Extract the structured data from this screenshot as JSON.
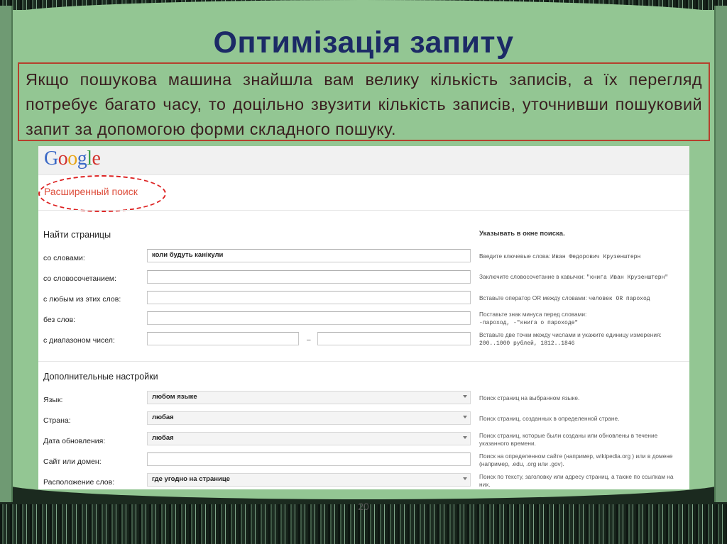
{
  "slide": {
    "title": "Оптимізація запиту",
    "text": "Якщо пошукова машина знайшла вам велику кількість записів, а їх перегляд  потребує багато часу, то доцільно звузити кількість записів, уточнивши пошуковий запит за допомогою форми складного пошуку.",
    "page_number": "20"
  },
  "google": {
    "logo": [
      "G",
      "o",
      "o",
      "g",
      "l",
      "e"
    ],
    "page_title": "Расширенный поиск",
    "find_pages": {
      "heading": "Найти страницы",
      "hint_heading": "Указывать в окне поиска.",
      "rows": [
        {
          "label": "со словами:",
          "value": "коли будуть канікули",
          "hint": "Введите ключевые слова: ",
          "hint_code": "Иван Федорович Крузенштерн",
          "hint_end": ""
        },
        {
          "label": "со словосочетанием:",
          "value": "",
          "hint": "Заключите словосочетание в кавычки: ",
          "hint_code": "\"книга Иван Крузенштерн\"",
          "hint_end": ""
        },
        {
          "label": "с любым из этих слов:",
          "value": "",
          "hint": "Вставьте оператор OR между словами: ",
          "hint_code": "человек OR пароход",
          "hint_end": ""
        },
        {
          "label": "без слов:",
          "value": "",
          "hint": "Поставьте знак минуса перед словами:",
          "hint_code": "-пароход, -\"книга о пароходе\"",
          "hint_end": ""
        },
        {
          "label": "с диапазоном чисел:",
          "value": "",
          "hint": "Вставьте две точки между числами и укажите единицу измерения:",
          "hint_code": "200..1000 рублей, 1812..1846",
          "hint_end": ""
        }
      ],
      "range_dash": "–"
    },
    "advanced": {
      "heading": "Дополнительные настройки",
      "rows": [
        {
          "label": "Язык:",
          "value": "любом языке",
          "hint": "Поиск страниц на выбранном языке."
        },
        {
          "label": "Страна:",
          "value": "любая",
          "hint": "Поиск страниц, созданных в определенной стране."
        },
        {
          "label": "Дата обновления:",
          "value": "любая",
          "hint": "Поиск страниц, которые были созданы или обновлены в течение указанного времени."
        },
        {
          "label": "Сайт или домен:",
          "value": "",
          "hint": "Поиск на определенном сайте (например,  wikipedia.org ) или в домене (например, .edu, .org или .gov)."
        },
        {
          "label": "Расположение слов:",
          "value": "где угодно на странице",
          "hint": "Поиск по тексту, заголовку или адресу страниц, а также по ссылкам на них."
        }
      ]
    }
  }
}
